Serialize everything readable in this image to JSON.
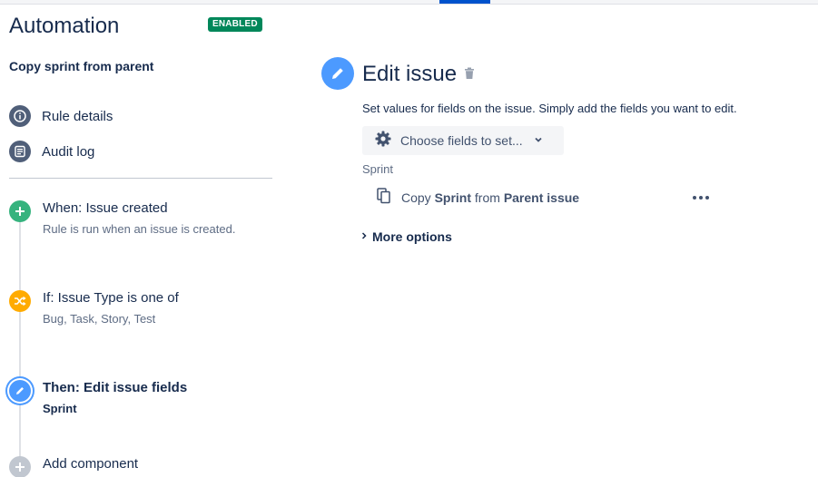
{
  "header": {
    "title": "Automation",
    "status_badge": "ENABLED"
  },
  "rule": {
    "name": "Copy sprint from parent"
  },
  "nav": [
    {
      "label": "Rule details",
      "icon": "info-icon"
    },
    {
      "label": "Audit log",
      "icon": "audit-log-icon"
    }
  ],
  "steps": [
    {
      "title": "When: Issue created",
      "subtitle": "Rule is run when an issue is created.",
      "icon": "plus-icon",
      "color": "#36b37e"
    },
    {
      "title": "If: Issue Type is one of",
      "subtitle": "Bug, Task, Story, Test",
      "icon": "shuffle-icon",
      "color": "#ffab00"
    },
    {
      "title": "Then: Edit issue fields",
      "subtitle": "Sprint",
      "icon": "pencil-icon",
      "color": "#4c9aff",
      "selected": true
    },
    {
      "title": "Add component",
      "icon": "plus-icon",
      "color": "#c1c7d0"
    }
  ],
  "panel": {
    "title": "Edit issue",
    "description": "Set values for fields on the issue. Simply add the fields you want to edit.",
    "choose_fields_label": "Choose fields to set...",
    "field_label": "Sprint",
    "copy_row": {
      "prefix": "Copy",
      "field": "Sprint",
      "middle": "from",
      "source": "Parent issue"
    },
    "more_options_label": "More options"
  },
  "colors": {
    "accent": "#0052cc",
    "enabled": "#00875a",
    "trigger": "#36b37e",
    "condition": "#ffab00",
    "action": "#4c9aff"
  }
}
